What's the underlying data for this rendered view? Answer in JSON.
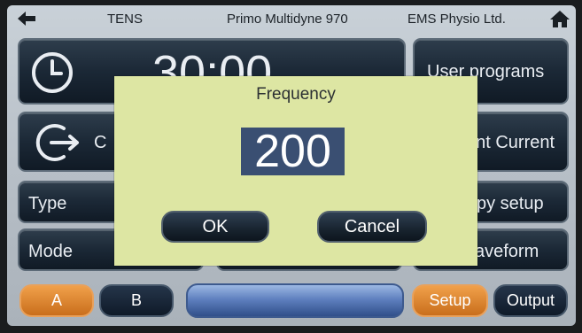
{
  "topbar": {
    "mode": "TENS",
    "device": "Primo Multidyne 970",
    "company": "EMS Physio Ltd.",
    "back_icon": "arrow-left-icon",
    "home_icon": "home-icon"
  },
  "timer": {
    "value": "30:00",
    "icon": "clock-icon"
  },
  "tiles": {
    "cc_partial": "C",
    "user_programs": "User programs",
    "constant_current": "ant Current",
    "type": "Type",
    "therapy_setup": "py setup",
    "mode": "Mode",
    "waveform": "aveform"
  },
  "bottom": {
    "a": "A",
    "b": "B",
    "setup": "Setup",
    "output": "Output"
  },
  "dialog": {
    "title": "Frequency",
    "value": "200",
    "ok": "OK",
    "cancel": "Cancel"
  },
  "colors": {
    "accent_orange": "#e08a30",
    "selection": "#3a4f72",
    "dialog_bg": "#dde6a3"
  }
}
